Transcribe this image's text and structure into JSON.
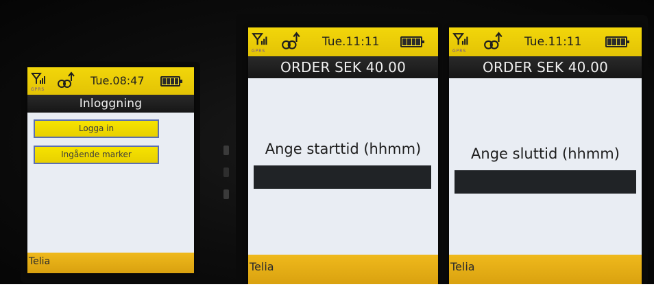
{
  "phones": [
    {
      "status": {
        "time": "Tue.08:47",
        "gprs": "GPRS"
      },
      "title": "Inloggning",
      "menu": [
        "Logga in",
        "Ingående marker"
      ],
      "footer": "Telia"
    },
    {
      "status": {
        "time": "Tue.11:11",
        "gprs": "GPRS"
      },
      "title": "ORDER SEK 40.00",
      "prompt": "Ange starttid (hhmm)",
      "input_value": "",
      "footer": "Telia"
    },
    {
      "status": {
        "time": "Tue.11:11",
        "gprs": "GPRS"
      },
      "title": "ORDER SEK 40.00",
      "prompt": "Ange sluttid (hhmm)",
      "input_value": "",
      "footer": "Telia"
    }
  ],
  "icons": {
    "signal": "signal-icon",
    "transfer": "transfer-icon",
    "battery": "battery-icon"
  },
  "colors": {
    "status_bar": "#e8c807",
    "title_bar": "#1c1c1c",
    "screen_bg": "#e9edf3",
    "menu_button": "#f0da00",
    "menu_border": "#5c6fb0",
    "footer": "#e2ad14",
    "input_field": "#202326"
  }
}
